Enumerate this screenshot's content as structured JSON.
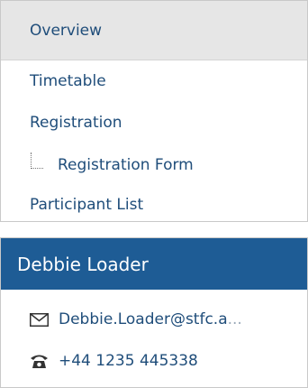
{
  "nav": {
    "items": [
      {
        "label": "Overview"
      },
      {
        "label": "Timetable"
      },
      {
        "label": "Registration"
      },
      {
        "label": "Registration Form"
      },
      {
        "label": "Participant List"
      }
    ]
  },
  "contact": {
    "name": "Debbie Loader",
    "email_visible": "Debbie.Loader@stfc.a",
    "email_overflow": "...",
    "phone": "+44 1235 445338",
    "email_icon": "envelope-icon",
    "phone_icon": "telephone-icon"
  },
  "colors": {
    "link": "#1f4d7a",
    "header_bg": "#1e5c95",
    "active_bg": "#e6e6e6"
  }
}
